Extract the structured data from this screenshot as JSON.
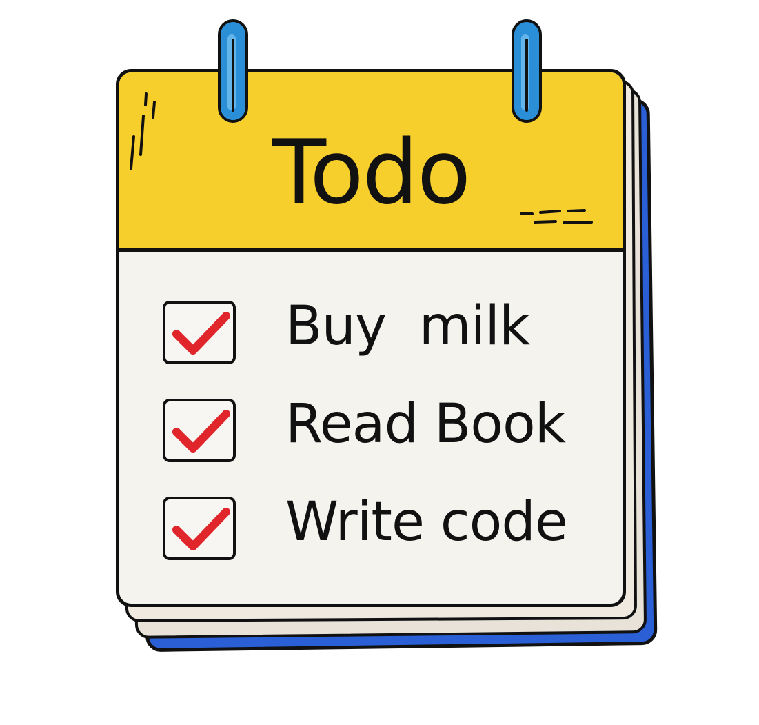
{
  "card": {
    "title": "Todo"
  },
  "tasks": [
    {
      "label": "Buy  milk",
      "checked": true
    },
    {
      "label": "Read Book",
      "checked": true
    },
    {
      "label": "Write code",
      "checked": true
    }
  ],
  "colors": {
    "header": "#f7cf2d",
    "paper": "#f4f3ee",
    "cover": "#2a5fd6",
    "rings": "#2b8fd8",
    "check": "#e0262b",
    "ink": "#111111"
  },
  "icons": {
    "ring": "binder-ring-icon",
    "check": "checkmark-icon"
  }
}
